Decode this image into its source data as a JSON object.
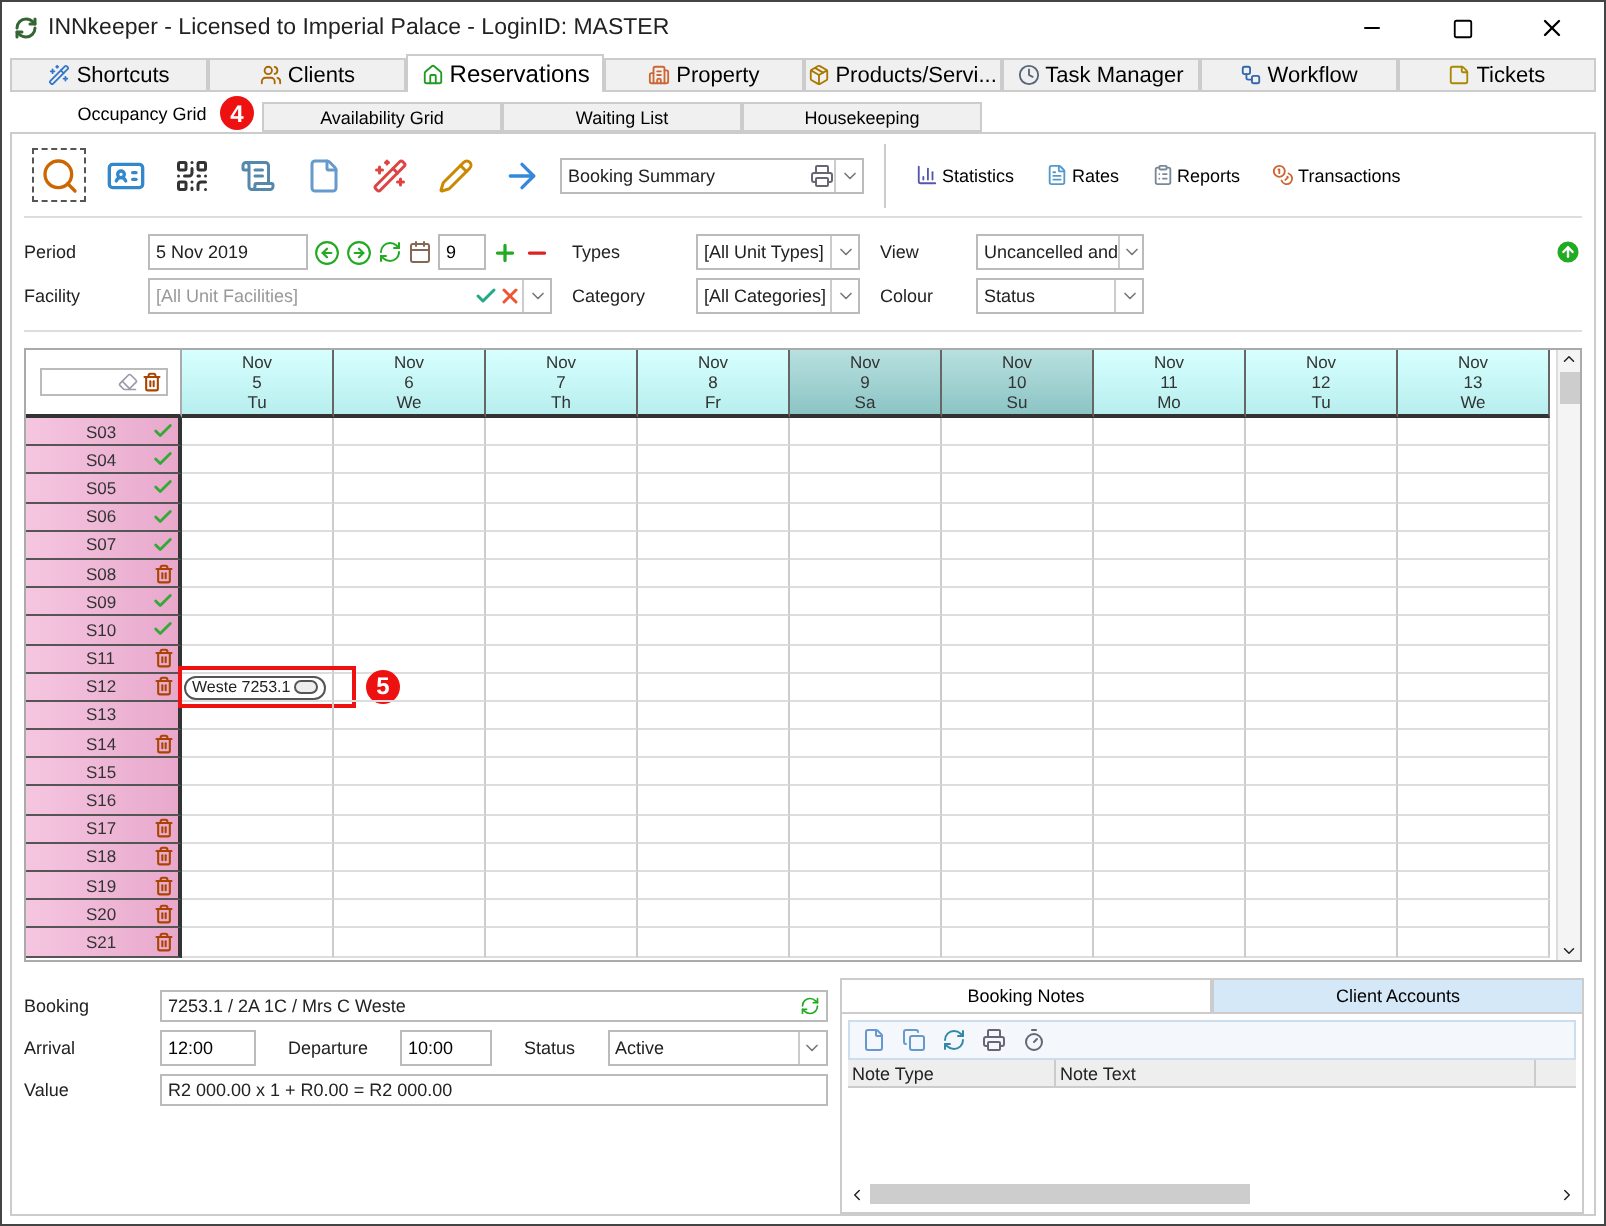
{
  "window": {
    "title": "INNkeeper - Licensed to Imperial Palace - LoginID: MASTER"
  },
  "tabs": [
    {
      "label": "Shortcuts",
      "selected": false
    },
    {
      "label": "Clients",
      "selected": false
    },
    {
      "label": "Reservations",
      "selected": true
    },
    {
      "label": "Property",
      "selected": false
    },
    {
      "label": "Products/Servi...",
      "selected": false
    },
    {
      "label": "Task Manager",
      "selected": false
    },
    {
      "label": "Workflow",
      "selected": false
    },
    {
      "label": "Tickets",
      "selected": false
    }
  ],
  "subtabs": [
    {
      "label": "Occupancy Grid",
      "selected": true
    },
    {
      "label": "Availability Grid",
      "selected": false
    },
    {
      "label": "Waiting List",
      "selected": false
    },
    {
      "label": "Housekeeping",
      "selected": false
    }
  ],
  "toolbar": {
    "report": "Booking Summary",
    "links": [
      "Statistics",
      "Rates",
      "Reports",
      "Transactions"
    ]
  },
  "filters": {
    "period_label": "Period",
    "period": "5 Nov 2019",
    "period_days": "9",
    "facility_label": "Facility",
    "facility_placeholder": "[All Unit Facilities]",
    "types_label": "Types",
    "types": "[All Unit Types]",
    "category_label": "Category",
    "category": "[All Categories]",
    "view_label": "View",
    "view": "Uncancelled and",
    "colour_label": "Colour",
    "colour": "Status"
  },
  "grid": {
    "days": [
      {
        "month": "Nov",
        "day": "5",
        "weekday": "Tu",
        "weekend": false
      },
      {
        "month": "Nov",
        "day": "6",
        "weekday": "We",
        "weekend": false
      },
      {
        "month": "Nov",
        "day": "7",
        "weekday": "Th",
        "weekend": false
      },
      {
        "month": "Nov",
        "day": "8",
        "weekday": "Fr",
        "weekend": false
      },
      {
        "month": "Nov",
        "day": "9",
        "weekday": "Sa",
        "weekend": true
      },
      {
        "month": "Nov",
        "day": "10",
        "weekday": "Su",
        "weekend": true
      },
      {
        "month": "Nov",
        "day": "11",
        "weekday": "Mo",
        "weekend": false
      },
      {
        "month": "Nov",
        "day": "12",
        "weekday": "Tu",
        "weekend": false
      },
      {
        "month": "Nov",
        "day": "13",
        "weekday": "We",
        "weekend": false
      }
    ],
    "units": [
      {
        "name": "S03",
        "kind": "clean"
      },
      {
        "name": "S04",
        "kind": "clean"
      },
      {
        "name": "S05",
        "kind": "clean"
      },
      {
        "name": "S06",
        "kind": "clean"
      },
      {
        "name": "S07",
        "kind": "clean"
      },
      {
        "name": "S08",
        "kind": "dirty"
      },
      {
        "name": "S09",
        "kind": "clean"
      },
      {
        "name": "S10",
        "kind": "clean"
      },
      {
        "name": "S11",
        "kind": "dirty"
      },
      {
        "name": "S12",
        "kind": "dirty",
        "booking": "Weste 7253.1",
        "callout": "5"
      },
      {
        "name": "S13",
        "kind": "plain"
      },
      {
        "name": "S14",
        "kind": "dirty"
      },
      {
        "name": "S15",
        "kind": "plain"
      },
      {
        "name": "S16",
        "kind": "plain"
      },
      {
        "name": "S17",
        "kind": "dirty"
      },
      {
        "name": "S18",
        "kind": "dirty"
      },
      {
        "name": "S19",
        "kind": "dirty"
      },
      {
        "name": "S20",
        "kind": "dirty"
      },
      {
        "name": "S21",
        "kind": "dirty"
      }
    ]
  },
  "subtab_callout": "4",
  "booking_form": {
    "booking_label": "Booking",
    "booking": "7253.1 / 2A 1C / Mrs C Weste",
    "arrival_label": "Arrival",
    "arrival": "12:00",
    "departure_label": "Departure",
    "departure": "10:00",
    "status_label": "Status",
    "status": "Active",
    "value_label": "Value",
    "value": "R2 000.00 x 1 + R0.00 = R2 000.00"
  },
  "notes": {
    "tabs": [
      {
        "label": "Booking Notes",
        "selected": true
      },
      {
        "label": "Client Accounts",
        "selected": false
      }
    ],
    "columns": [
      "Note Type",
      "Note Text"
    ]
  }
}
